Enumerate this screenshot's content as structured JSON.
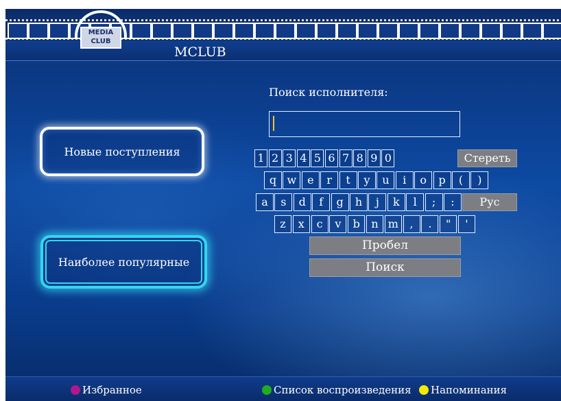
{
  "header": {
    "title": "MCLUB",
    "logo_text_top": "MEDIA",
    "logo_text_bottom": "CLUB"
  },
  "menu": {
    "new_arrivals": "Новые поступления",
    "most_popular": "Наиболее популярные"
  },
  "search": {
    "label": "Поиск исполнителя:",
    "value": ""
  },
  "keyboard": {
    "row1": [
      "1",
      "2",
      "3",
      "4",
      "5",
      "6",
      "7",
      "8",
      "9",
      "0"
    ],
    "row1_action": "Стереть",
    "row2": [
      "q",
      "w",
      "e",
      "r",
      "t",
      "y",
      "u",
      "i",
      "o",
      "p",
      "(",
      ")"
    ],
    "row3": [
      "a",
      "s",
      "d",
      "f",
      "g",
      "h",
      "j",
      "k",
      "l",
      ";",
      ":"
    ],
    "row3_action": "Рус",
    "row4": [
      "z",
      "x",
      "c",
      "v",
      "b",
      "n",
      "m",
      ",",
      ".",
      "\"",
      "'"
    ],
    "space": "Пробел",
    "search": "Поиск"
  },
  "footer": {
    "favorites": "Избранное",
    "playlist": "Список воспроизведения",
    "reminders": "Напоминания"
  },
  "colors": {
    "favorites_dot": "#b0188c",
    "playlist_dot": "#1fae1f",
    "reminders_dot": "#f5ea00",
    "accent": "#33d6f0"
  }
}
